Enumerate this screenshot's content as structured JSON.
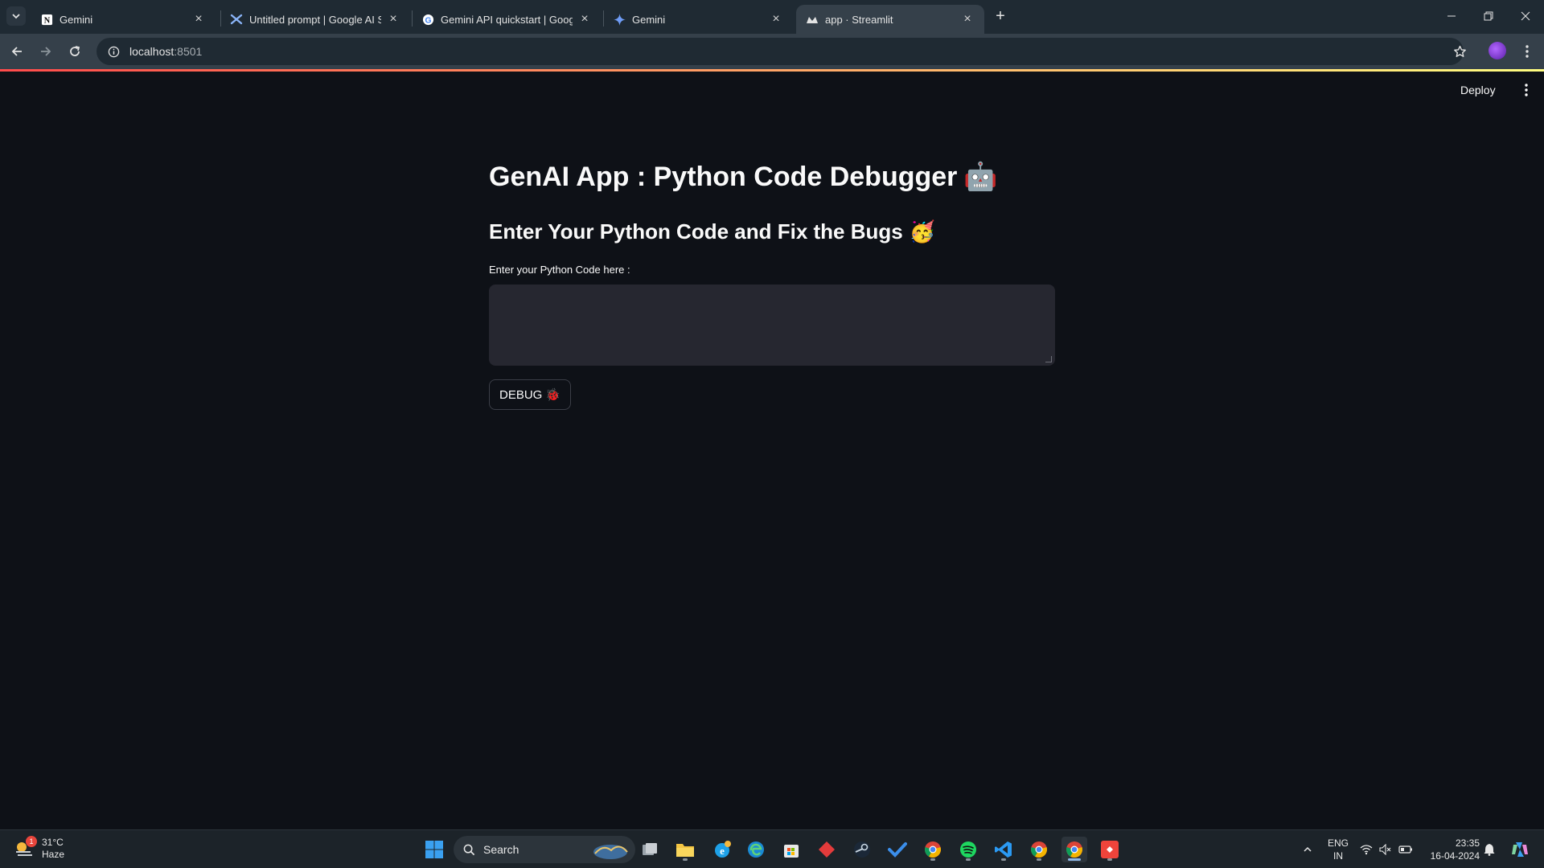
{
  "browser": {
    "tabs": [
      {
        "title": "Gemini",
        "icon": "notion-icon"
      },
      {
        "title": "Untitled prompt | Google AI Studio",
        "icon": "ai-studio-icon"
      },
      {
        "title": "Gemini API quickstart | Google AI",
        "icon": "google-icon"
      },
      {
        "title": "Gemini",
        "icon": "gemini-sparkle-icon"
      },
      {
        "title": "app · Streamlit",
        "icon": "streamlit-icon"
      }
    ],
    "url_host": "localhost",
    "url_port": ":8501"
  },
  "app": {
    "deploy_label": "Deploy",
    "title": "GenAI App : Python Code Debugger",
    "title_emoji": "🤖",
    "subheader": "Enter Your Python Code and Fix the Bugs",
    "subheader_emoji": "🥳",
    "input_label": "Enter your Python Code here :",
    "input_value": "",
    "button_label": "DEBUG",
    "button_emoji": "🐞",
    "colors": {
      "background": "#0e1117",
      "input_bg": "#262730",
      "accent": "#ff4b4b"
    }
  },
  "taskbar": {
    "weather_temp": "31°C",
    "weather_desc": "Haze",
    "weather_badge": "1",
    "search_placeholder": "Search",
    "lang_top": "ENG",
    "lang_bottom": "IN",
    "time": "23:35",
    "date": "16-04-2024"
  }
}
